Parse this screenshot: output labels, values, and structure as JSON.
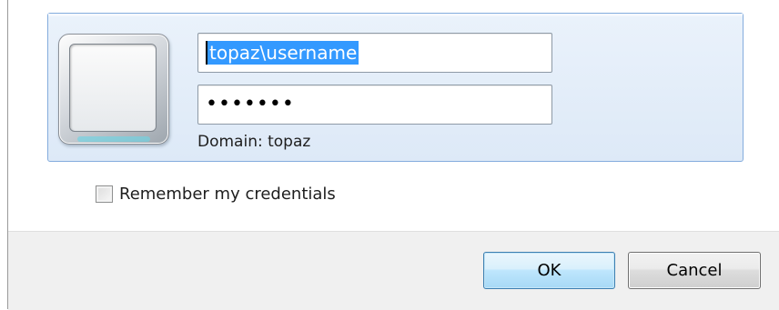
{
  "credential_tile": {
    "username_value": "topaz\\username",
    "password_mask": "•••••••",
    "domain_label": "Domain: topaz"
  },
  "options": {
    "remember_label": "Remember my credentials",
    "remember_checked": false
  },
  "footer": {
    "ok_label": "OK",
    "cancel_label": "Cancel"
  },
  "icons": {
    "user_tile": "user-tile-icon",
    "checkbox": "checkbox-icon"
  },
  "colors": {
    "tile_border": "#84acdd",
    "tile_background": "#dde9f7",
    "selection": "#3399ff",
    "footer_background": "#f0f0f0",
    "ok_border": "#3c7fb1"
  }
}
